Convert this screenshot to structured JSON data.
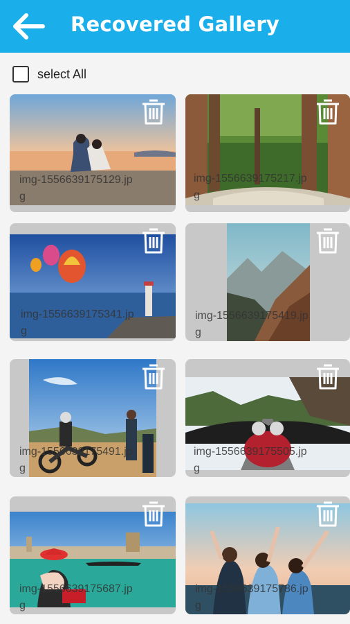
{
  "appbar": {
    "title": "Recovered Gallery",
    "back_icon": "arrow-left-icon",
    "color": "#1aaeea"
  },
  "select_all": {
    "label": "select All",
    "checked": false
  },
  "gallery": {
    "items": [
      {
        "filename_line1": "img-1556639175129.jp",
        "filename_line2": "g",
        "scene": "couple-beach-sunset"
      },
      {
        "filename_line1": "img-1556639175217.jp",
        "filename_line2": "g",
        "scene": "forest-road"
      },
      {
        "filename_line1": "img-1556639175341.jp",
        "filename_line2": "g",
        "scene": "balloons-lighthouse"
      },
      {
        "filename_line1": "img-1556639175419.jp",
        "filename_line2": "g",
        "scene": "mountain-cliffs"
      },
      {
        "filename_line1": "img-1556639175491.jp",
        "filename_line2": "g",
        "scene": "motorbike-riders"
      },
      {
        "filename_line1": "img-1556639175505.jp",
        "filename_line2": "g",
        "scene": "motorcycle-handlebars"
      },
      {
        "filename_line1": "img-1556639175687.jp",
        "filename_line2": "g",
        "scene": "woman-venice"
      },
      {
        "filename_line1": "img-1556639175786.jp",
        "filename_line2": "g",
        "scene": "friends-cheering"
      }
    ]
  }
}
